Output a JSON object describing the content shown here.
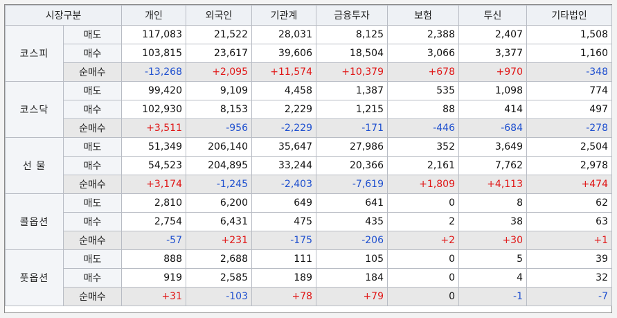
{
  "headers": [
    "시장구분",
    "개인",
    "외국인",
    "기관계",
    "금융투자",
    "보험",
    "투신",
    "기타법인"
  ],
  "row_labels": [
    "매도",
    "매수",
    "순매수"
  ],
  "markets": [
    {
      "name": "코스피",
      "rows": [
        [
          "117,083",
          "21,522",
          "28,031",
          "8,125",
          "2,388",
          "2,407",
          "1,508"
        ],
        [
          "103,815",
          "23,617",
          "39,606",
          "18,504",
          "3,066",
          "3,377",
          "1,160"
        ],
        [
          "-13,268",
          "+2,095",
          "+11,574",
          "+10,379",
          "+678",
          "+970",
          "-348"
        ]
      ]
    },
    {
      "name": "코스닥",
      "rows": [
        [
          "99,420",
          "9,109",
          "4,458",
          "1,387",
          "535",
          "1,098",
          "774"
        ],
        [
          "102,930",
          "8,153",
          "2,229",
          "1,215",
          "88",
          "414",
          "497"
        ],
        [
          "+3,511",
          "-956",
          "-2,229",
          "-171",
          "-446",
          "-684",
          "-278"
        ]
      ]
    },
    {
      "name": "선  물",
      "rows": [
        [
          "51,349",
          "206,140",
          "35,647",
          "27,986",
          "352",
          "3,649",
          "2,504"
        ],
        [
          "54,523",
          "204,895",
          "33,244",
          "20,366",
          "2,161",
          "7,762",
          "2,978"
        ],
        [
          "+3,174",
          "-1,245",
          "-2,403",
          "-7,619",
          "+1,809",
          "+4,113",
          "+474"
        ]
      ]
    },
    {
      "name": "콜옵션",
      "rows": [
        [
          "2,810",
          "6,200",
          "649",
          "641",
          "0",
          "8",
          "62"
        ],
        [
          "2,754",
          "6,431",
          "475",
          "435",
          "2",
          "38",
          "63"
        ],
        [
          "-57",
          "+231",
          "-175",
          "-206",
          "+2",
          "+30",
          "+1"
        ]
      ]
    },
    {
      "name": "풋옵션",
      "rows": [
        [
          "888",
          "2,688",
          "111",
          "105",
          "0",
          "5",
          "39"
        ],
        [
          "919",
          "2,585",
          "189",
          "184",
          "0",
          "4",
          "32"
        ],
        [
          "+31",
          "-103",
          "+78",
          "+79",
          "0",
          "-1",
          "-7"
        ]
      ]
    }
  ],
  "colors": {
    "positive": "#e01515",
    "negative": "#1e4fcf",
    "net_row_bg": "#e8e8e8",
    "individual_header": "#fbdcdc",
    "foreign_header": "#f6e4cd",
    "institution_header": "#e4f1da",
    "other_corp_header": "#f1e5cc"
  }
}
